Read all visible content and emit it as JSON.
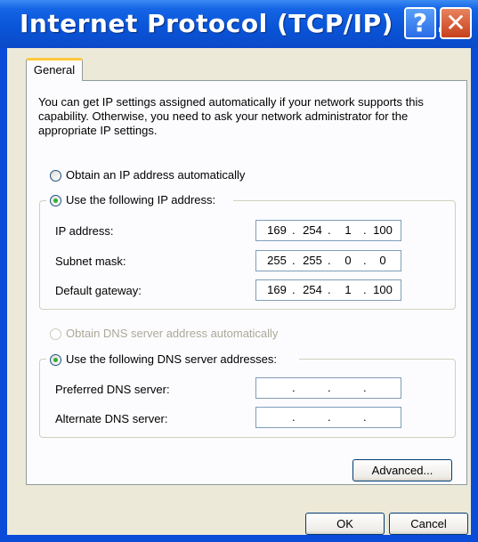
{
  "window": {
    "title": "Internet Protocol (TCP/IP) P...",
    "help_glyph": "?",
    "close_glyph": "✕"
  },
  "tabs": [
    {
      "label": "General"
    }
  ],
  "intro_text": "You can get IP settings assigned automatically if your network supports this capability. Otherwise, you need to ask your network administrator for the appropriate IP settings.",
  "ip_section": {
    "auto_label": "Obtain an IP address automatically",
    "manual_label": "Use the following IP address:",
    "selected": "manual",
    "fields": [
      {
        "label": "IP address:",
        "octets": [
          "169",
          "254",
          "1",
          "100"
        ]
      },
      {
        "label": "Subnet mask:",
        "octets": [
          "255",
          "255",
          "0",
          "0"
        ]
      },
      {
        "label": "Default gateway:",
        "octets": [
          "169",
          "254",
          "1",
          "100"
        ]
      }
    ]
  },
  "dns_section": {
    "auto_label": "Obtain DNS server address automatically",
    "auto_enabled": false,
    "manual_label": "Use the following DNS server addresses:",
    "selected": "manual",
    "fields": [
      {
        "label": "Preferred DNS server:",
        "octets": [
          "",
          "",
          "",
          ""
        ]
      },
      {
        "label": "Alternate DNS server:",
        "octets": [
          "",
          "",
          "",
          ""
        ]
      }
    ]
  },
  "buttons": {
    "advanced": "Advanced...",
    "ok": "OK",
    "cancel": "Cancel"
  },
  "colors": {
    "titlebar": "#0a55d8",
    "dialog_bg": "#ece9d8",
    "radio_dot": "#2fb02f",
    "close_button": "#c8401c"
  }
}
